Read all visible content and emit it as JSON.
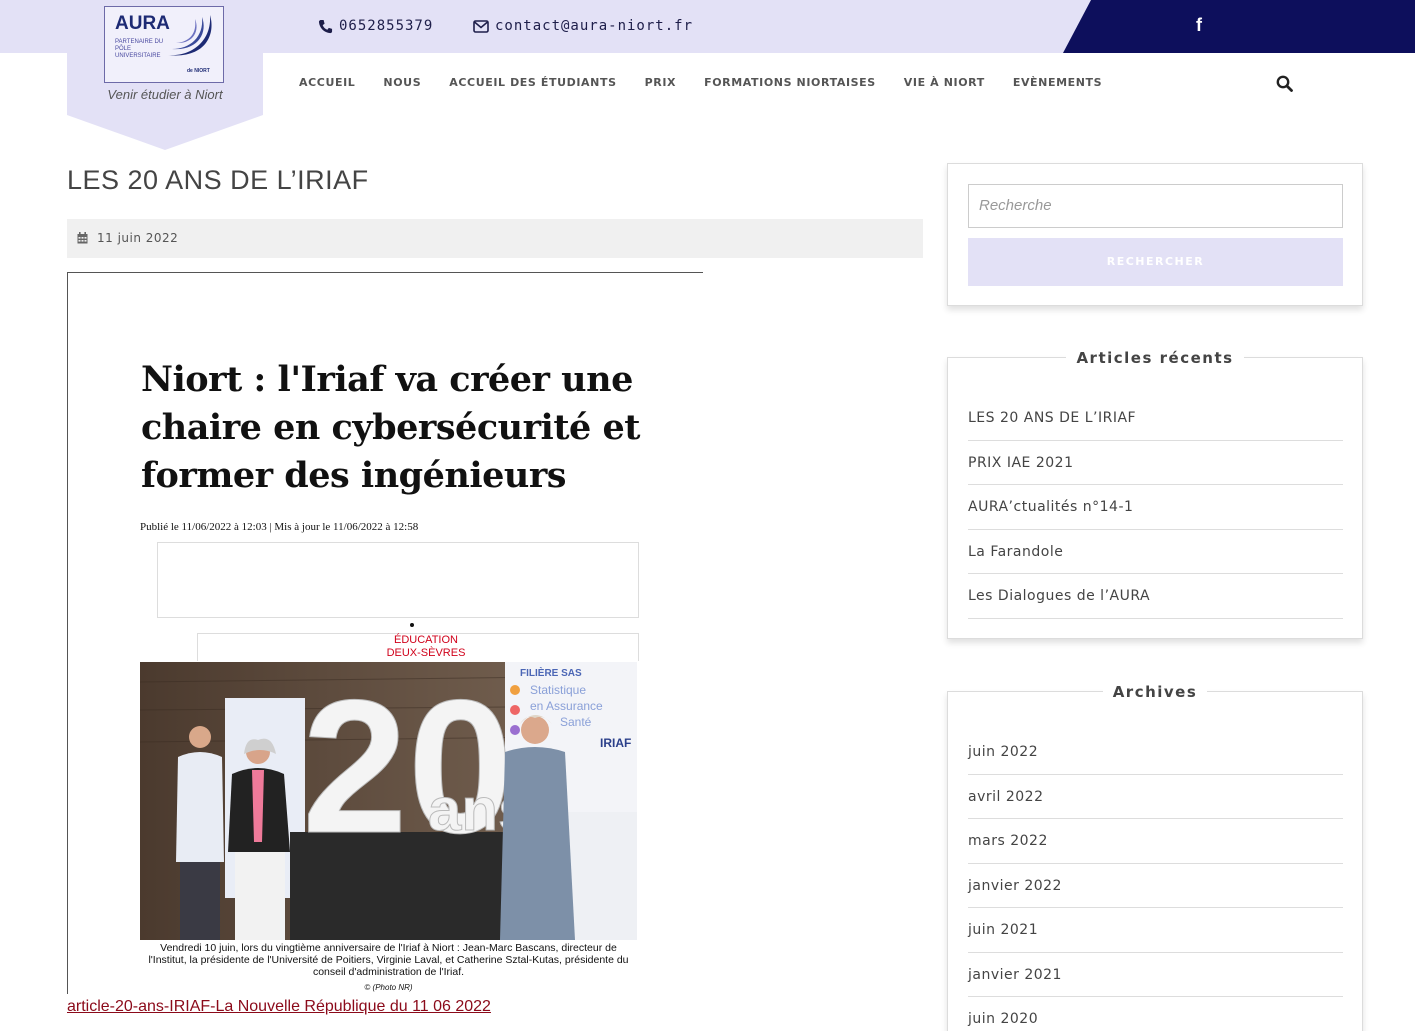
{
  "header": {
    "phone": "0652855379",
    "email": "contact@aura-niort.fr",
    "social": "facebook-icon"
  },
  "logo": {
    "name": "AURA",
    "subtitle": "PARTENAIRE DU PÔLE UNIVERSITAIRE",
    "city_mark": "de NIORT",
    "tagline": "Venir étudier à Niort"
  },
  "nav": {
    "items": [
      {
        "label": "ACCUEIL"
      },
      {
        "label": "NOUS"
      },
      {
        "label": "ACCUEIL DES ÉTUDIANTS"
      },
      {
        "label": "PRIX"
      },
      {
        "label": "FORMATIONS NIORTAISES"
      },
      {
        "label": "VIE À NIORT"
      },
      {
        "label": "EVÈNEMENTS"
      }
    ]
  },
  "post": {
    "title": "LES 20 ANS DE L’IRIAF",
    "date": "11 juin 2022",
    "attachment_link": "article-20-ans-IRIAF-La Nouvelle République du 11 06 2022"
  },
  "clipping": {
    "headline": "Niort : l'Iriaf va créer une chaire en cybersécurité et former des ingénieurs",
    "published": "Publié le 11/06/2022 à 12:03 | Mis à jour le 11/06/2022 à 12:58",
    "category_1": "ÉDUCATION",
    "category_2": "DEUX-SÈVRES",
    "photo_big_text": "20",
    "photo_ans": "ans",
    "photo_banner_1": "FILIÈRE SAS",
    "photo_banner_2": "Statistique",
    "photo_banner_3": "en Assurance",
    "photo_banner_4": "Santé",
    "photo_banner_5": "IRIAF",
    "caption": "Vendredi 10 juin, lors du vingtième anniversaire de l'Iriaf à Niort : Jean-Marc Bascans, directeur de l'Institut, la présidente de l'Université de Poitiers, Virginie Laval, et Catherine Sztal-Kutas, présidente du conseil d'administration de l'Iriaf.",
    "credit": "© (Photo NR)"
  },
  "sidebar": {
    "search": {
      "placeholder": "Recherche",
      "button": "RECHERCHER"
    },
    "recent": {
      "title": "Articles récents",
      "items": [
        "LES 20 ANS DE L’IRIAF",
        "PRIX IAE 2021",
        "AURA’ctualités n°14-1",
        "La Farandole",
        "Les Dialogues de l’AURA"
      ]
    },
    "archives": {
      "title": "Archives",
      "items": [
        "juin 2022",
        "avril 2022",
        "mars 2022",
        "janvier 2022",
        "juin 2021",
        "janvier 2021",
        "juin 2020"
      ]
    }
  },
  "colors": {
    "lavender": "#e3e1f6",
    "navy": "#0d0f5c",
    "link": "#8b0a1a",
    "category_red": "#d0021b"
  }
}
